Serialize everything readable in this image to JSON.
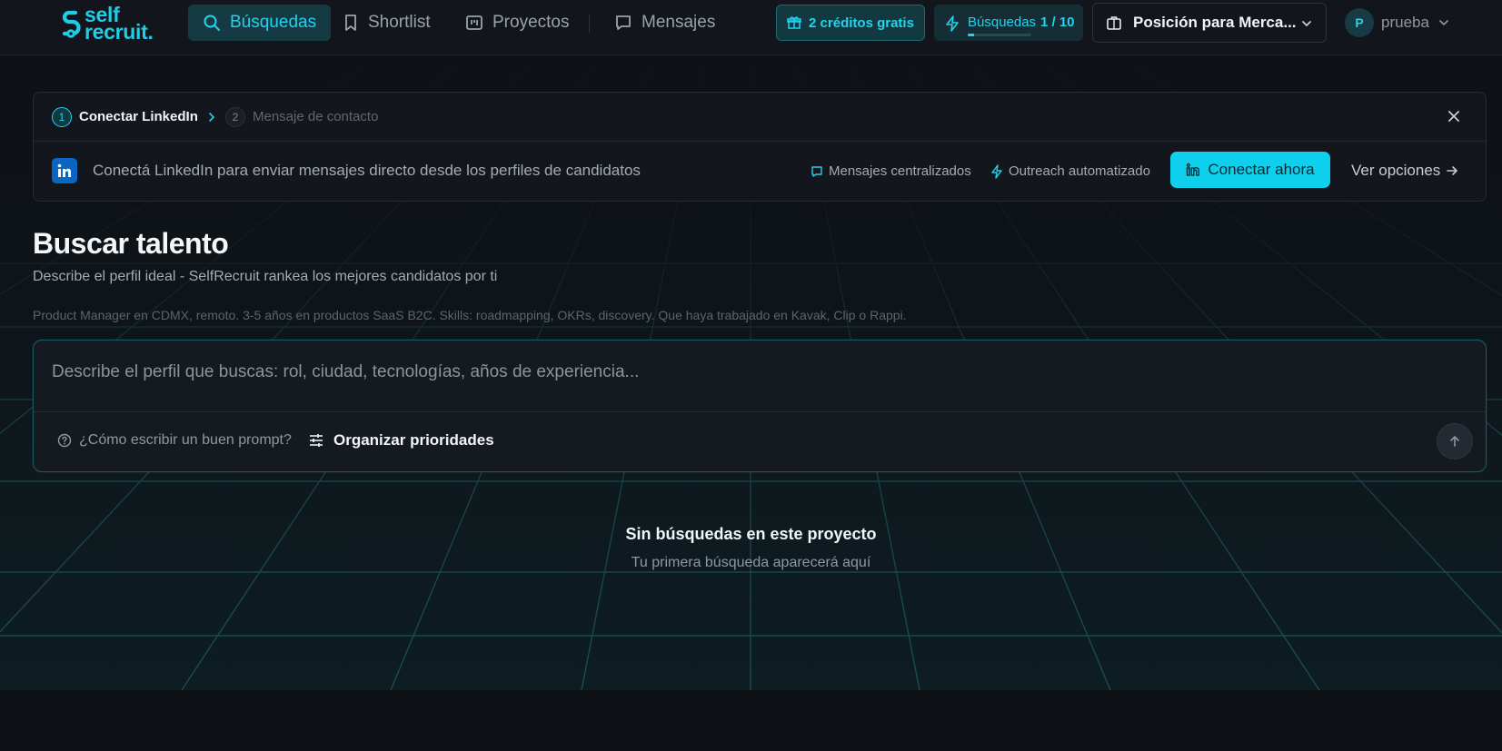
{
  "header": {
    "logo_line1": "self",
    "logo_line2": "recruit.",
    "nav": [
      {
        "label": "Búsquedas",
        "active": true
      },
      {
        "label": "Shortlist"
      },
      {
        "label": "Proyectos"
      },
      {
        "label": "Mensajes"
      }
    ],
    "credits_label": "2 créditos gratis",
    "searches_label": "Búsquedas",
    "searches_count": "1 / 10",
    "searches_progress": 0.1,
    "project_name": "Posición para Merca...",
    "user_initial": "P",
    "user_name": "prueba"
  },
  "banner": {
    "step1_number": "1",
    "step1_label": "Conectar LinkedIn",
    "step2_number": "2",
    "step2_label": "Mensaje de contacto",
    "text": "Conectá LinkedIn para enviar mensajes directo desde los perfiles de candidatos",
    "feature1": "Mensajes centralizados",
    "feature2": "Outreach automatizado",
    "connect_label": "Conectar ahora",
    "options_label": "Ver opciones"
  },
  "main": {
    "title": "Buscar talento",
    "subtitle": "Describe el perfil ideal - SelfRecruit rankea los mejores candidatos por ti",
    "example": "Product Manager en CDMX, remoto. 3-5 años en productos SaaS B2C. Skills: roadmapping, OKRs, discovery. Que haya trabajado en Kavak, Clip o Rappi.",
    "prompt_placeholder": "Describe el perfil que buscas: rol, ciudad, tecnologías, años de experiencia...",
    "prompt_value": "",
    "help_label": "¿Cómo escribir un buen prompt?",
    "priorities_label": "Organizar prioridades",
    "empty_title": "Sin búsquedas en este proyecto",
    "empty_subtitle": "Tu primera búsqueda aparecerá aquí"
  },
  "colors": {
    "accent": "#22d3ee",
    "background": "#0e1217",
    "linkedin": "#0a66c2"
  }
}
